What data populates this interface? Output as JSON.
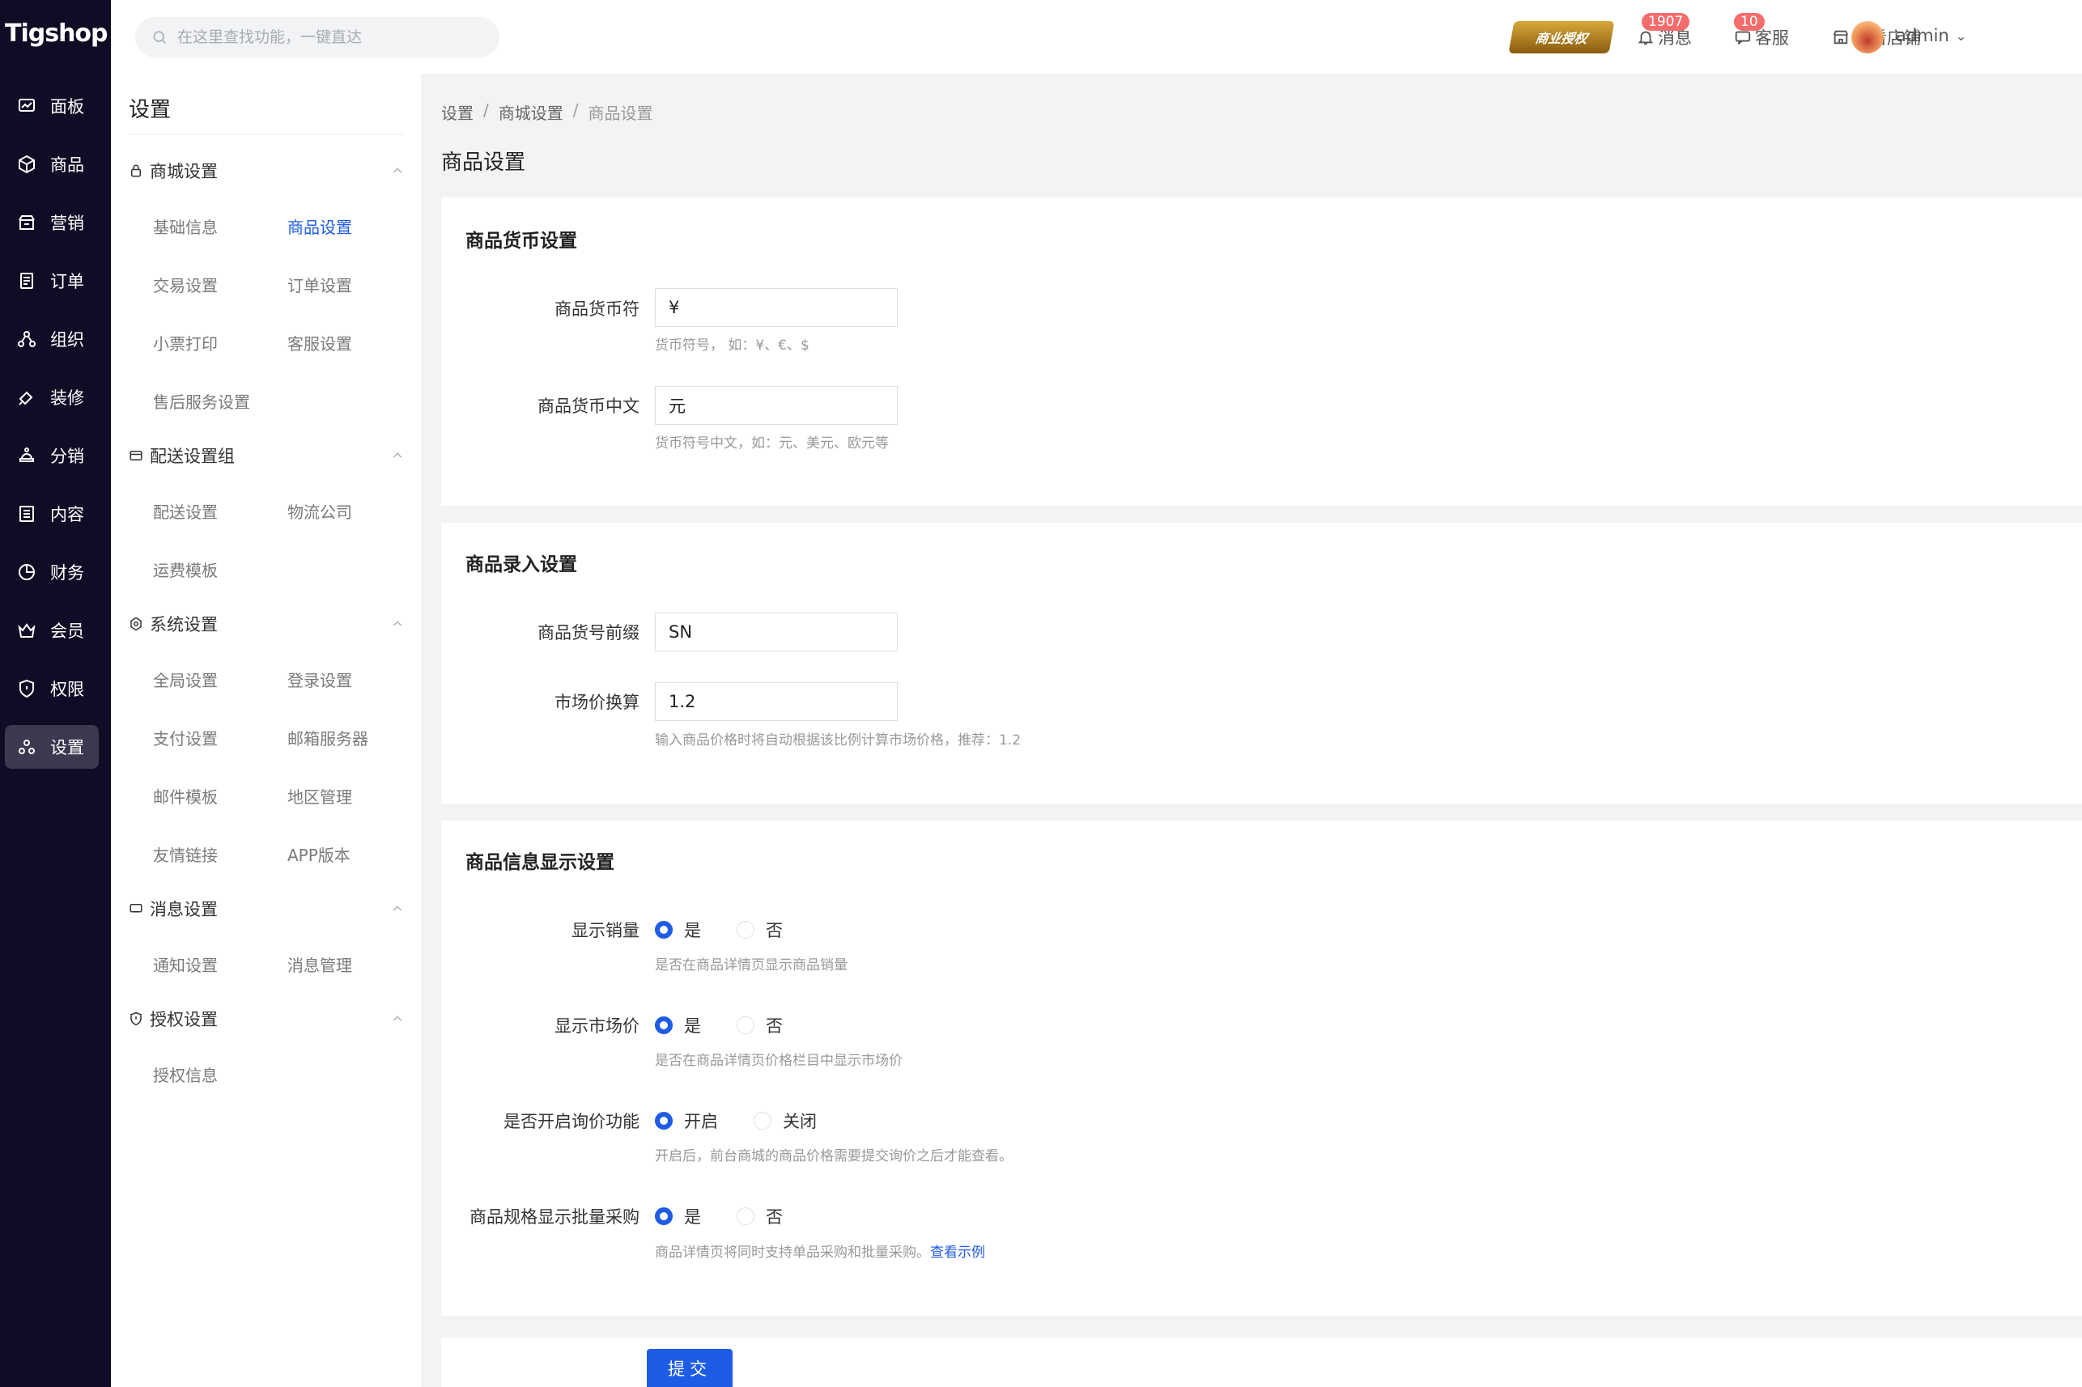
{
  "brand": {
    "logo": "Tigshop"
  },
  "nav": [
    {
      "label": "面板",
      "icon": "dashboard-icon"
    },
    {
      "label": "商品",
      "icon": "box-icon"
    },
    {
      "label": "营销",
      "icon": "marketing-icon"
    },
    {
      "label": "订单",
      "icon": "order-icon"
    },
    {
      "label": "组织",
      "icon": "org-icon"
    },
    {
      "label": "装修",
      "icon": "paint-icon"
    },
    {
      "label": "分销",
      "icon": "distribution-icon"
    },
    {
      "label": "内容",
      "icon": "content-icon"
    },
    {
      "label": "财务",
      "icon": "finance-icon"
    },
    {
      "label": "会员",
      "icon": "member-icon"
    },
    {
      "label": "权限",
      "icon": "shield-icon"
    },
    {
      "label": "设置",
      "icon": "settings-icon",
      "active": true
    }
  ],
  "topbar": {
    "search_placeholder": "在这里查找功能，一键直达",
    "license": "商业授权",
    "messages_label": "消息",
    "messages_badge": "1907",
    "service_label": "客服",
    "service_badge": "10",
    "store_label": "查看店铺",
    "user": "admin"
  },
  "submenu": {
    "title": "设置",
    "groups": [
      {
        "label": "商城设置",
        "items": [
          "基础信息",
          "商品设置",
          "交易设置",
          "订单设置",
          "小票打印",
          "客服设置",
          "售后服务设置"
        ]
      },
      {
        "label": "配送设置组",
        "items": [
          "配送设置",
          "物流公司",
          "运费模板"
        ]
      },
      {
        "label": "系统设置",
        "items": [
          "全局设置",
          "登录设置",
          "支付设置",
          "邮箱服务器",
          "邮件模板",
          "地区管理",
          "友情链接",
          "APP版本"
        ]
      },
      {
        "label": "消息设置",
        "items": [
          "通知设置",
          "消息管理"
        ]
      },
      {
        "label": "授权设置",
        "items": [
          "授权信息"
        ]
      }
    ]
  },
  "breadcrumb": [
    "设置",
    "商城设置",
    "商品设置"
  ],
  "page_title": "商品设置",
  "sections": {
    "currency": {
      "title": "商品货币设置",
      "symbol_label": "商品货币符",
      "symbol_value": "¥",
      "symbol_hint": "货币符号， 如：¥、€、$",
      "cn_label": "商品货币中文",
      "cn_value": "元",
      "cn_hint": "货币符号中文，如：元、美元、欧元等"
    },
    "entry": {
      "title": "商品录入设置",
      "prefix_label": "商品货号前缀",
      "prefix_value": "SN",
      "ratio_label": "市场价换算",
      "ratio_value": "1.2",
      "ratio_hint": "输入商品价格时将自动根据该比例计算市场价格，推荐：1.2"
    },
    "display": {
      "title": "商品信息显示设置",
      "sales_label": "显示销量",
      "sales_yes": "是",
      "sales_no": "否",
      "sales_hint": "是否在商品详情页显示商品销量",
      "market_label": "显示市场价",
      "market_yes": "是",
      "market_no": "否",
      "market_hint": "是否在商品详情页价格栏目中显示市场价",
      "inquiry_label": "是否开启询价功能",
      "inquiry_on": "开启",
      "inquiry_off": "关闭",
      "inquiry_hint": "开启后，前台商城的商品价格需要提交询价之后才能查看。",
      "bulk_label": "商品规格显示批量采购",
      "bulk_yes": "是",
      "bulk_no": "否",
      "bulk_hint": "商品详情页将同时支持单品采购和批量采购。",
      "bulk_link": "查看示例"
    }
  },
  "submit_label": "提交",
  "colors": {
    "primary": "#1e5ce6",
    "nav_bg": "#0f0d26",
    "badge": "#f56c6c"
  }
}
